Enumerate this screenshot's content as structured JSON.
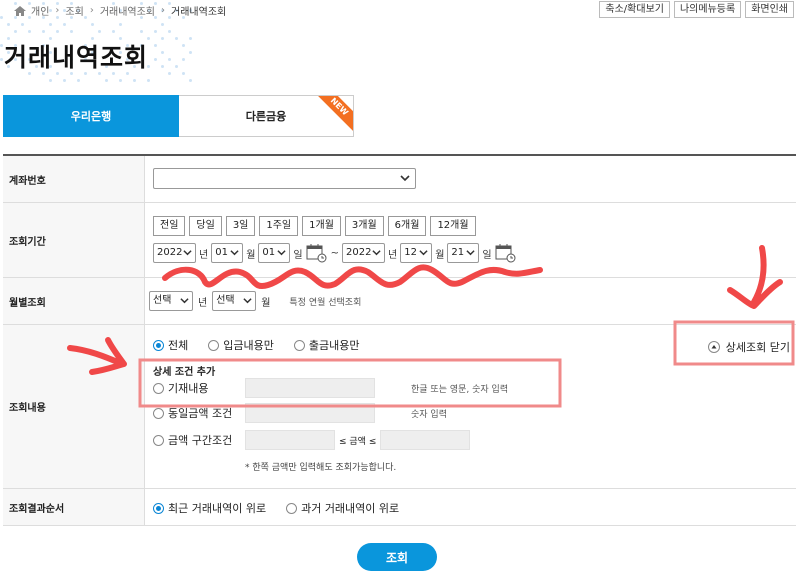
{
  "breadcrumb": [
    "개인",
    "조회",
    "거래내역조회",
    "거래내역조회"
  ],
  "top_buttons": [
    "축소/확대보기",
    "나의메뉴등록",
    "화면인쇄"
  ],
  "page_title": "거래내역조회",
  "tabs": [
    {
      "label": "우리은행",
      "active": true
    },
    {
      "label": "다른금융",
      "badge": "NEW"
    }
  ],
  "rows": {
    "account": {
      "label": "계좌번호",
      "value": ""
    },
    "period": {
      "label": "조회기간",
      "buttons": [
        "전일",
        "당일",
        "3일",
        "1주일",
        "1개월",
        "3개월",
        "6개월",
        "12개월"
      ],
      "from": {
        "year": "2022",
        "month": "01",
        "day": "01"
      },
      "to": {
        "year": "2022",
        "month": "12",
        "day": "21"
      },
      "unit_year": "년",
      "unit_month": "월",
      "unit_day": "일",
      "tilde": "~"
    },
    "monthly": {
      "label": "월별조회",
      "year_select": "선택",
      "month_select": "선택",
      "unit_year": "년",
      "unit_month": "월",
      "hint": "특정 연월 선택조회"
    },
    "detail": {
      "label": "조회내용",
      "radios": [
        "전체",
        "입금내용만",
        "출금내용만"
      ],
      "selected": "전체",
      "toggle": "상세조회 닫기",
      "sub_title": "상세 조건 추가",
      "cond_memo": "기재내용",
      "cond_memo_hint": "한글 또는 영문, 숫자 입력",
      "cond_same": "동일금액 조건",
      "cond_same_hint": "숫자 입력",
      "cond_range": "금액 구간조건",
      "range_mid": "≤ 금액 ≤",
      "note": "* 한쪽 금액만 입력해도 조회가능합니다."
    },
    "order": {
      "label": "조회결과순서",
      "radios": [
        "최근 거래내역이 위로",
        "과거 거래내역이 위로"
      ],
      "selected": "최근 거래내역이 위로"
    }
  },
  "search_button": "조회",
  "colors": {
    "primary": "#0a96dc",
    "badge": "#f36f21",
    "annotation": "#f04848"
  }
}
